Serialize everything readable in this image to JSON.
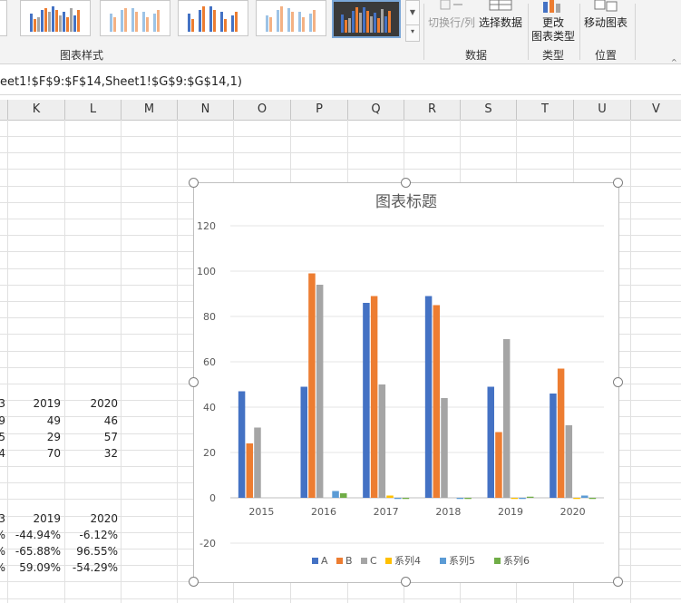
{
  "ribbon": {
    "group_chart_styles": "图表样式",
    "group_data": "数据",
    "group_type": "类型",
    "group_location": "位置",
    "switch_row_col": "切换行/列",
    "select_data": "选择数据",
    "change_type_line1": "更改",
    "change_type_line2": "图表类型",
    "move_chart": "移动图表"
  },
  "formula_bar": {
    "text": "eet1!$F$9:$F$14,Sheet1!$G$9:$G$14,1)"
  },
  "columns": [
    "K",
    "L",
    "M",
    "N",
    "O",
    "P",
    "Q",
    "R",
    "S",
    "T",
    "U",
    "V"
  ],
  "table1": {
    "rows": [
      [
        "3",
        "2019",
        "2020"
      ],
      [
        "9",
        "49",
        "46"
      ],
      [
        "5",
        "29",
        "57"
      ],
      [
        "4",
        "70",
        "32"
      ]
    ]
  },
  "table2": {
    "rows": [
      [
        "3",
        "2019",
        "2020"
      ],
      [
        "%",
        "-44.94%",
        "-6.12%"
      ],
      [
        "%",
        "-65.88%",
        "96.55%"
      ],
      [
        "%",
        "59.09%",
        "-54.29%"
      ]
    ]
  },
  "colors": {
    "A": "#4472c4",
    "B": "#ed7d31",
    "C": "#a5a5a5",
    "s4": "#ffc000",
    "s5": "#5b9bd5",
    "s6": "#70ad47"
  },
  "chart_data": {
    "type": "bar",
    "title": "图表标题",
    "categories": [
      "2015",
      "2016",
      "2017",
      "2018",
      "2019",
      "2020"
    ],
    "ylim": [
      -20,
      120
    ],
    "yticks": [
      "120",
      "100",
      "80",
      "60",
      "40",
      "20",
      "0",
      "-20"
    ],
    "grid": true,
    "legend_position": "bottom",
    "series": [
      {
        "name": "A",
        "values": [
          47,
          49,
          86,
          89,
          49,
          46
        ]
      },
      {
        "name": "B",
        "values": [
          24,
          99,
          89,
          85,
          29,
          57
        ]
      },
      {
        "name": "C",
        "values": [
          31,
          94,
          50,
          44,
          70,
          32
        ]
      },
      {
        "name": "系列4",
        "values": [
          0,
          0,
          1,
          0,
          -0.5,
          -0.5
        ]
      },
      {
        "name": "系列5",
        "values": [
          0,
          3,
          -0.5,
          -0.5,
          -0.5,
          1
        ]
      },
      {
        "name": "系列6",
        "values": [
          0,
          2,
          -0.5,
          -0.5,
          0.5,
          -0.5
        ]
      }
    ]
  }
}
